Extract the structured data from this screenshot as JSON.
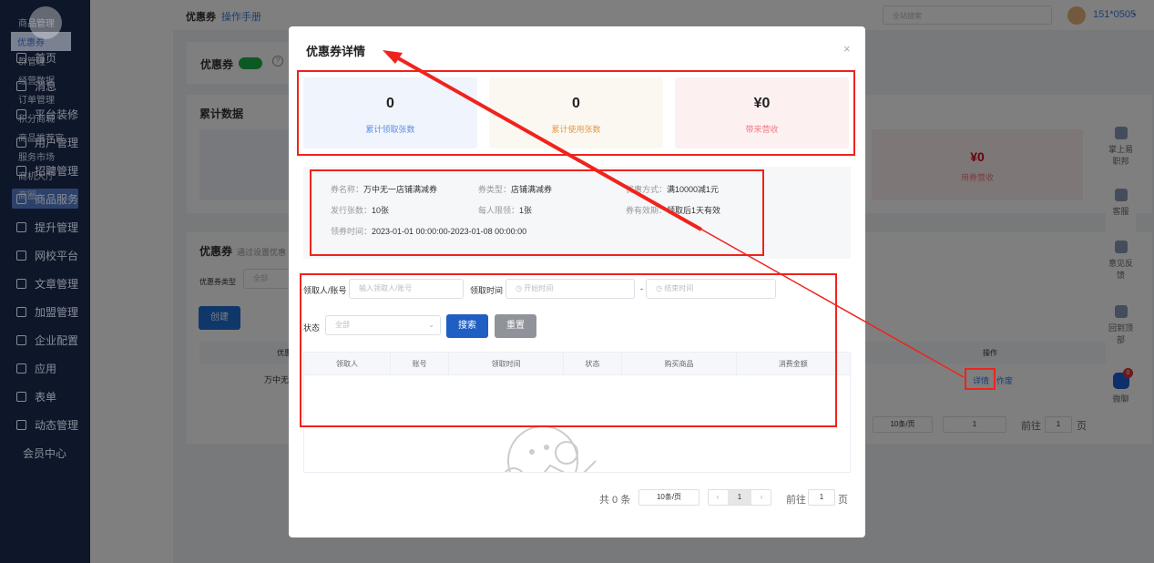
{
  "sidebar": {
    "items": [
      "首页",
      "消息",
      "平台装修",
      "用户管理",
      "招聘管理",
      "商品服务",
      "提升管理",
      "网校平台",
      "文章管理",
      "加盟管理",
      "企业配置",
      "应用",
      "表单",
      "动态管理"
    ],
    "active": "商品服务",
    "member_center": "会员中心"
  },
  "submenu": {
    "items": [
      "商品管理",
      "优惠券",
      "群管理",
      "经营数据",
      "订单管理",
      "积分商城",
      "商品推荐官",
      "服务市场",
      "商机大厅",
      "商圈"
    ],
    "active": "优惠券"
  },
  "header": {
    "breadcrumb": "优惠券",
    "manual_link": "操作手册",
    "search_placeholder": "全站搜索",
    "user": "151*0505"
  },
  "background": {
    "coupon_toggle_label": "优惠券",
    "toggle_on": true,
    "stats_title": "累计数据",
    "revenue_value": "¥0",
    "revenue_label": "用券营收",
    "list_title": "优惠券",
    "list_desc": "通过设置优惠",
    "type_label": "优惠券类型",
    "type_value": "全部",
    "create_button": "创建",
    "col_coupon": "优惠",
    "col_action": "操作",
    "row_name": "万中无一",
    "row_detail": "详情",
    "row_void": "作废",
    "page_size": "10条/页",
    "page": "1",
    "goto_label": "前往",
    "goto_value": "1",
    "page_unit": "页"
  },
  "right_toolbar": [
    "掌上易职邦",
    "客服",
    "意见反馈",
    "回到顶部",
    "微聊"
  ],
  "chat_badge": "0",
  "modal": {
    "title": "优惠券详情",
    "stats": [
      {
        "value": "0",
        "label": "累计领取张数",
        "color": "#5b8fe0",
        "bg": "#f0f4fc"
      },
      {
        "value": "0",
        "label": "累计使用张数",
        "color": "#e09a4f",
        "bg": "#fbf8f1"
      },
      {
        "value": "¥0",
        "label": "带来营收",
        "color": "#ee7b85",
        "bg": "#fdf0f0"
      }
    ],
    "info": {
      "name_label": "券名称：",
      "name": "万中无一店铺满减券",
      "type_label": "券类型：",
      "type": "店铺满减券",
      "discount_label": "优惠方式：",
      "discount": "满10000减1元",
      "issued_label": "发行张数：",
      "issued": "10张",
      "limit_label": "每人限领：",
      "limit": "1张",
      "validity_label": "券有效期：",
      "validity": "领取后1天有效",
      "claim_time_label": "领券时间：",
      "claim_time": "2023-01-01 00:00:00-2023-01-08 00:00:00"
    },
    "filters": {
      "receiver_label": "领取人/账号",
      "receiver_placeholder": "输入领取人/账号",
      "time_label": "领取时间",
      "start_placeholder": "开始时间",
      "sep": "-",
      "end_placeholder": "结束时间",
      "status_label": "状态",
      "status_value": "全部",
      "search": "搜索",
      "reset": "重置"
    },
    "table": {
      "columns": [
        "领取人",
        "账号",
        "领取时间",
        "状态",
        "购买商品",
        "消费金额"
      ],
      "rows": []
    },
    "pagination": {
      "total": "共 0 条",
      "page_size": "10条/页",
      "page": "1",
      "goto_label": "前往",
      "goto_value": "1",
      "page_unit": "页"
    }
  }
}
